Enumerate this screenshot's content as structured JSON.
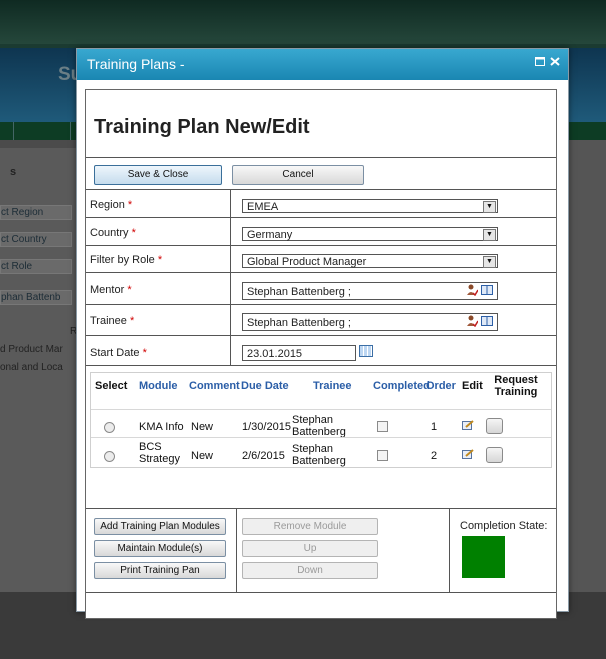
{
  "background": {
    "header_fragment": "Su",
    "left_panel_title": "s",
    "left_items": [
      "ct Region",
      "ct Country",
      "ct Role",
      "phan Battenb"
    ],
    "left_texts": [
      "R",
      "d Product Mar",
      "onal and Loca"
    ]
  },
  "dialog": {
    "title": "Training Plans -",
    "heading": "Training Plan New/Edit",
    "buttons": {
      "save_close": "Save & Close",
      "cancel": "Cancel"
    },
    "form": {
      "region": {
        "label": "Region",
        "required": "*",
        "value": "EMEA",
        "icon": "chevron-down-icon"
      },
      "country": {
        "label": "Country",
        "required": "*",
        "value": "Germany",
        "icon": "chevron-down-icon"
      },
      "role": {
        "label": "Filter by Role",
        "required": "*",
        "value": "Global Product Manager",
        "icon": "chevron-down-icon"
      },
      "mentor": {
        "label": "Mentor",
        "required": "*",
        "value": "Stephan Battenberg ;",
        "icons": [
          "person-check-icon",
          "address-book-icon"
        ]
      },
      "trainee": {
        "label": "Trainee",
        "required": "*",
        "value": "Stephan Battenberg ;",
        "icons": [
          "person-check-icon",
          "address-book-icon"
        ]
      },
      "start_date": {
        "label": "Start Date",
        "required": "*",
        "value": "23.01.2015",
        "icon": "calendar-icon"
      }
    },
    "grid": {
      "headers": {
        "select": "Select",
        "module": "Module",
        "comment": "Comment",
        "due_date": "Due Date",
        "trainee": "Trainee",
        "completed": "Completed",
        "order": "Order",
        "edit": "Edit",
        "request_1": "Request",
        "request_2": "Training"
      },
      "rows": [
        {
          "module": "KMA Info",
          "module_2": "",
          "comment": "New",
          "due_date": "1/30/2015",
          "trainee_1": "Stephan",
          "trainee_2": "Battenberg",
          "order": "1"
        },
        {
          "module": "BCS",
          "module_2": "Strategy",
          "comment": "New",
          "due_date": "2/6/2015",
          "trainee_1": "Stephan",
          "trainee_2": "Battenberg",
          "order": "2"
        }
      ]
    },
    "actions": {
      "add_modules": "Add Training Plan Modules",
      "maintain": "Maintain Module(s)",
      "print": "Print Training Pan",
      "remove": "Remove Module",
      "up": "Up",
      "down": "Down"
    },
    "completion": {
      "label": "Completion State:",
      "color": "#008000"
    },
    "colors": {
      "titlebar": "#1f8fbb",
      "link_header": "#2b5ea7",
      "required": "#d00000"
    }
  }
}
